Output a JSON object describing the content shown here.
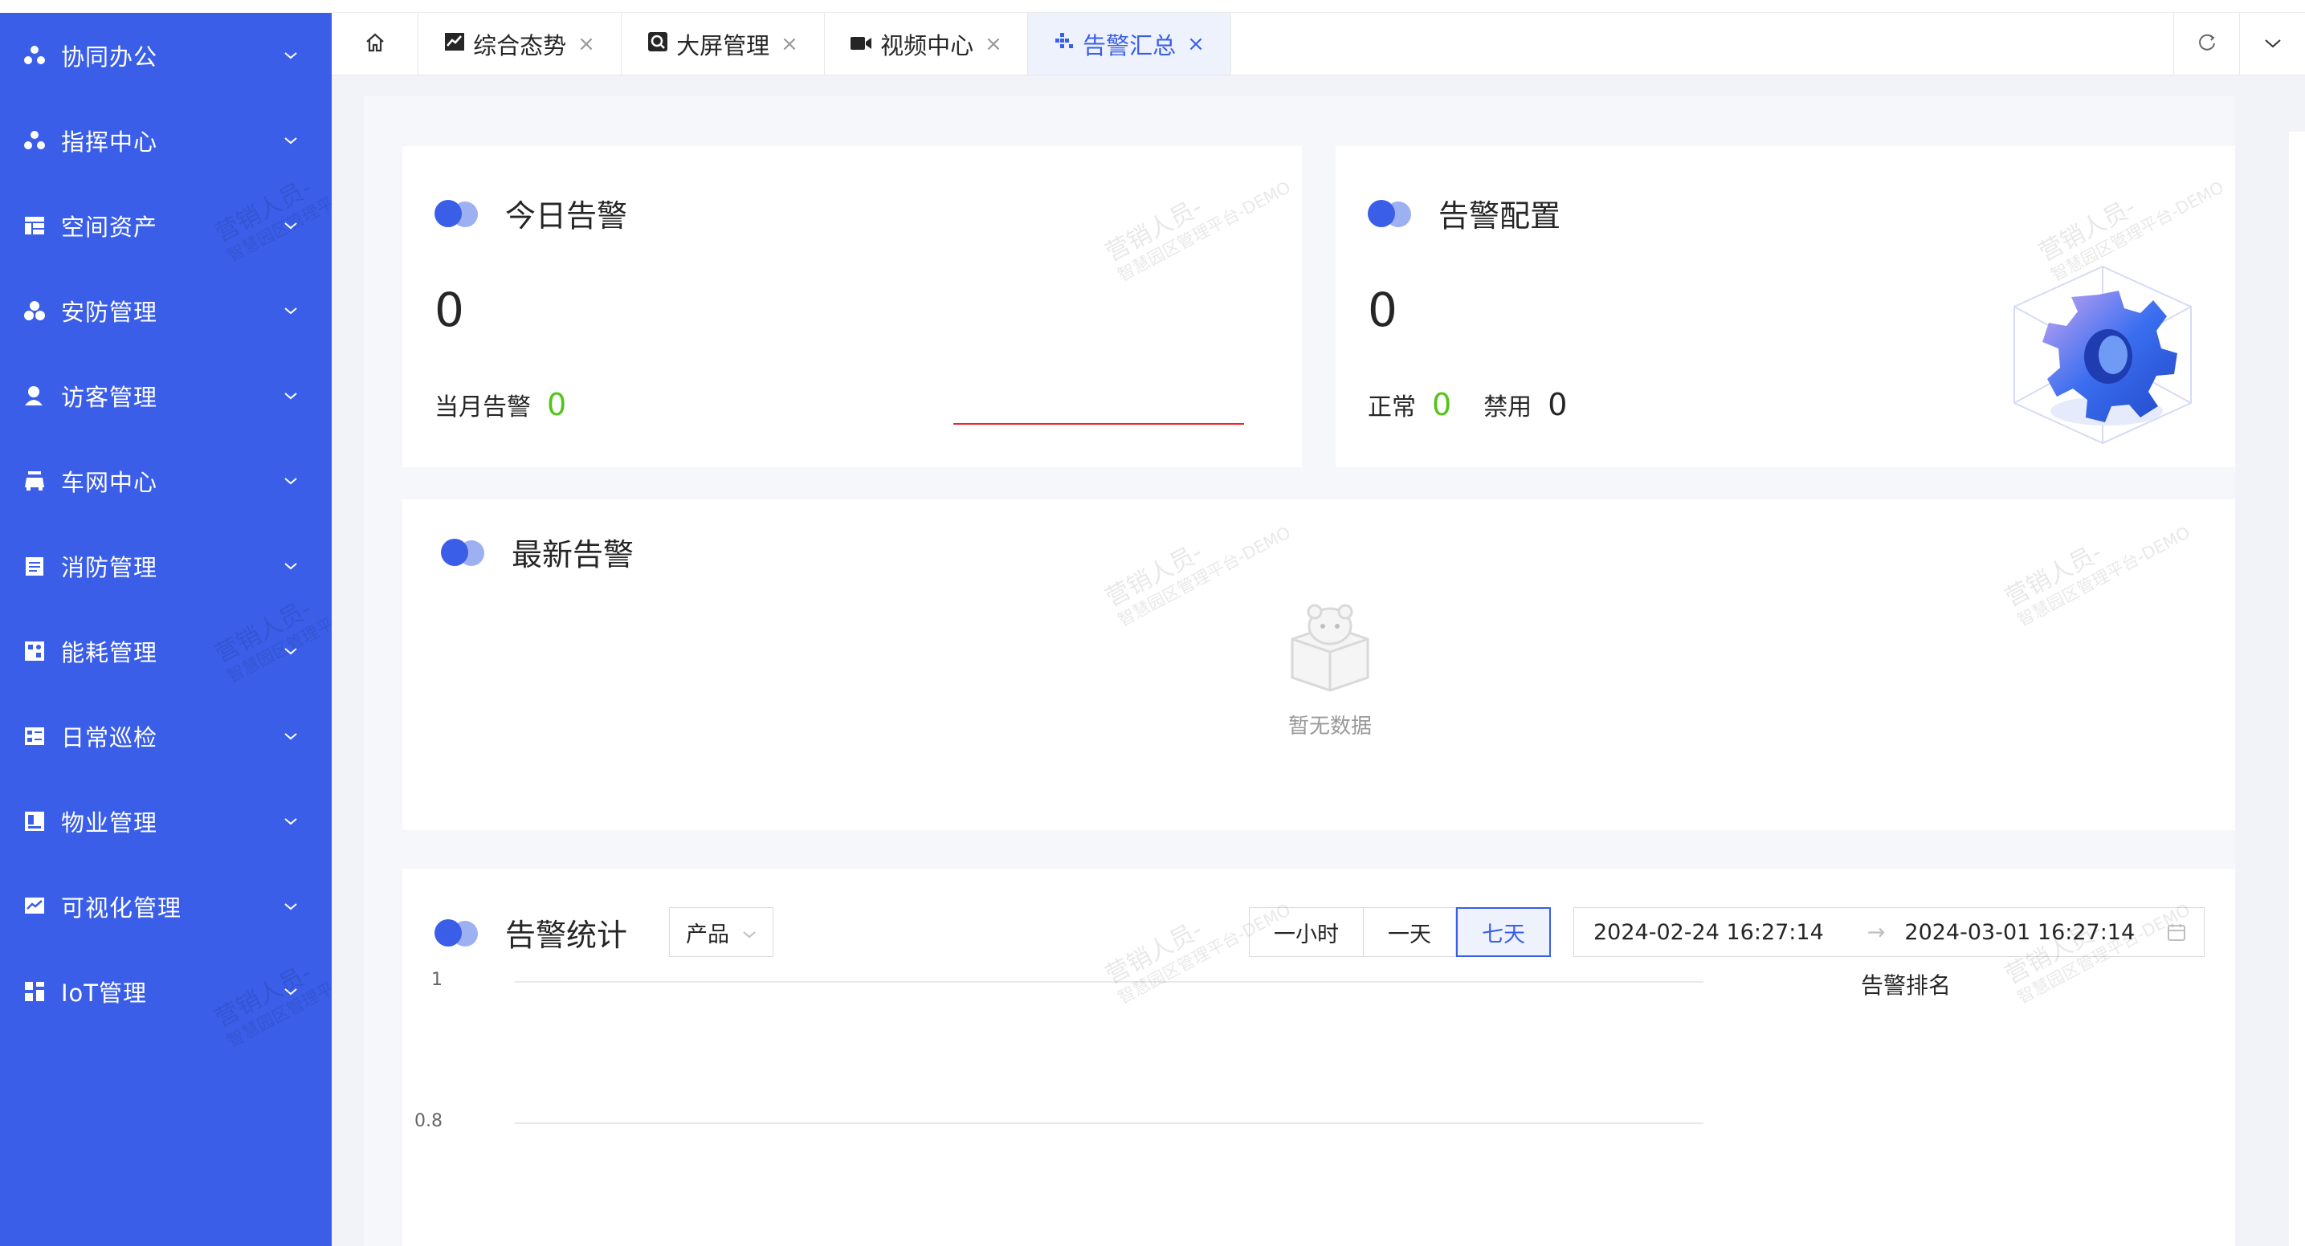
{
  "sidebar": {
    "items": [
      {
        "label": "协同办公",
        "icon": "cluster-icon"
      },
      {
        "label": "指挥中心",
        "icon": "cluster-icon"
      },
      {
        "label": "空间资产",
        "icon": "table-icon"
      },
      {
        "label": "安防管理",
        "icon": "shield-cluster-icon"
      },
      {
        "label": "访客管理",
        "icon": "user-icon"
      },
      {
        "label": "车网中心",
        "icon": "car-icon"
      },
      {
        "label": "消防管理",
        "icon": "clipboard-icon"
      },
      {
        "label": "能耗管理",
        "icon": "grid-icon"
      },
      {
        "label": "日常巡检",
        "icon": "list-icon"
      },
      {
        "label": "物业管理",
        "icon": "building-icon"
      },
      {
        "label": "可视化管理",
        "icon": "chart-icon"
      },
      {
        "label": "IoT管理",
        "icon": "iot-icon"
      }
    ]
  },
  "tabs": {
    "items": [
      {
        "label": "综合态势",
        "icon": "line-chart-icon",
        "close": "×"
      },
      {
        "label": "大屏管理",
        "icon": "screen-icon",
        "close": "×"
      },
      {
        "label": "视频中心",
        "icon": "video-icon",
        "close": "×"
      },
      {
        "label": "告警汇总",
        "icon": "dots-icon",
        "close": "×",
        "active": true
      }
    ]
  },
  "today_alarm": {
    "title": "今日告警",
    "value": "0",
    "month_label": "当月告警",
    "month_value": "0"
  },
  "alarm_config": {
    "title": "告警配置",
    "value": "0",
    "normal_label": "正常",
    "normal_value": "0",
    "disabled_label": "禁用",
    "disabled_value": "0"
  },
  "latest_alarm": {
    "title": "最新告警",
    "empty_text": "暂无数据"
  },
  "alarm_stats": {
    "title": "告警统计",
    "select_value": "产品",
    "ranges": [
      "一小时",
      "一天",
      "七天"
    ],
    "active_range": "七天",
    "start_time": "2024-02-24 16:27:14",
    "end_time": "2024-03-01 16:27:14",
    "arrow": "→",
    "y_ticks": [
      "1",
      "0.8"
    ],
    "rank_title": "告警排名"
  },
  "colors": {
    "accent": "#3a5ee8",
    "success": "#52c41a",
    "danger": "#f5222d"
  }
}
